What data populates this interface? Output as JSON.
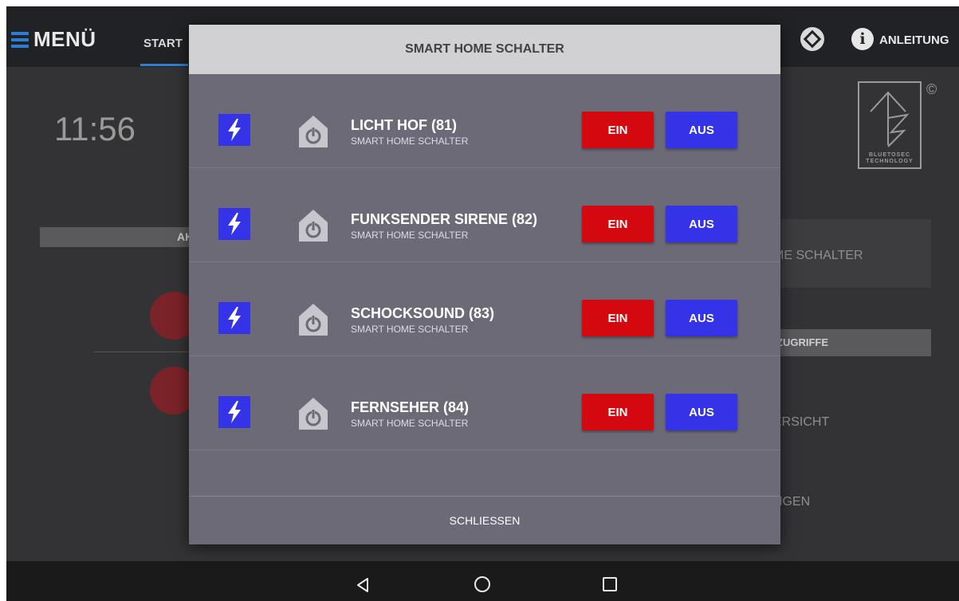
{
  "topbar": {
    "menu_label": "MENÜ",
    "start_tab": "START",
    "guide_label": "ANLEITUNG",
    "icons": [
      "hamburger-icon",
      "layers-icon",
      "info-icon"
    ]
  },
  "background": {
    "clock": "11:56",
    "left_bar_label": "AK",
    "right_panel_label": "ME SCHALTER",
    "right_bar_label": "ZUGRIFFE",
    "right_item_1": "ERSICHT",
    "right_item_2": "NGEN",
    "logo_copyright": "©",
    "logo_text_1": "BLUETOSEC",
    "logo_text_2": "TECHNOLOGY"
  },
  "dialog": {
    "title": "SMART HOME SCHALTER",
    "close_label": "SCHLIESSEN",
    "items": [
      {
        "title": "LICHT HOF (81)",
        "subtitle": "SMART HOME SCHALTER",
        "on_label": "EIN",
        "off_label": "AUS"
      },
      {
        "title": "FUNKSENDER SIRENE (82)",
        "subtitle": "SMART HOME SCHALTER",
        "on_label": "EIN",
        "off_label": "AUS"
      },
      {
        "title": "SCHOCKSOUND (83)",
        "subtitle": "SMART HOME SCHALTER",
        "on_label": "EIN",
        "off_label": "AUS"
      },
      {
        "title": "FERNSEHER (84)",
        "subtitle": "SMART HOME SCHALTER",
        "on_label": "EIN",
        "off_label": "AUS"
      }
    ]
  },
  "colors": {
    "accent_blue": "#3433e8",
    "on_red": "#d4080f",
    "dialog_bg": "#6d6a78",
    "header_bg": "#d1d1d3",
    "menu_blue": "#2e7fd1"
  },
  "navbar": {
    "icons": [
      "back-icon",
      "home-icon",
      "recent-apps-icon"
    ]
  }
}
